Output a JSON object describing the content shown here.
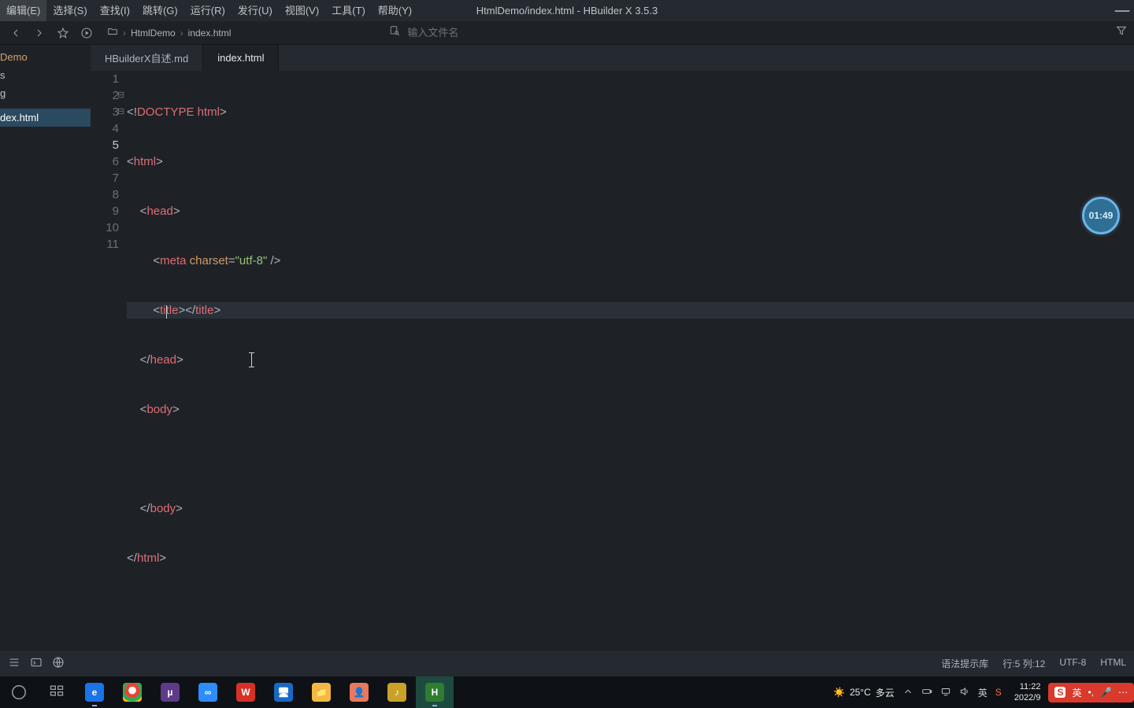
{
  "window": {
    "title": "HtmlDemo/index.html - HBuilder X 3.5.3"
  },
  "menu": {
    "items": [
      "编辑(E)",
      "选择(S)",
      "查找(I)",
      "跳转(G)",
      "运行(R)",
      "发行(U)",
      "视图(V)",
      "工具(T)",
      "帮助(Y)"
    ]
  },
  "toolbar": {
    "breadcrumb": [
      "HtmlDemo",
      "index.html"
    ],
    "search_placeholder": "输入文件名"
  },
  "sidebar": {
    "items": [
      "Demo",
      "s",
      "g",
      "",
      "dex.html"
    ],
    "active_index": 4
  },
  "tabs": {
    "items": [
      "HBuilderX自述.md",
      "index.html"
    ],
    "active_index": 1
  },
  "editor": {
    "line_count": 11,
    "fold_markers": {
      "2": "⊟",
      "3": "⊟"
    },
    "cursor": {
      "line": 5,
      "col": 12
    }
  },
  "statusbar": {
    "syntax_hint": "语法提示库",
    "position": "行:5  列:12",
    "encoding": "UTF-8",
    "language": "HTML"
  },
  "timer": {
    "value": "01:49"
  },
  "taskbar": {
    "weather": {
      "temp": "25°C",
      "text": "多云"
    },
    "clock": {
      "time": "11:22",
      "date": "2022/9"
    },
    "ime_text": "英"
  }
}
